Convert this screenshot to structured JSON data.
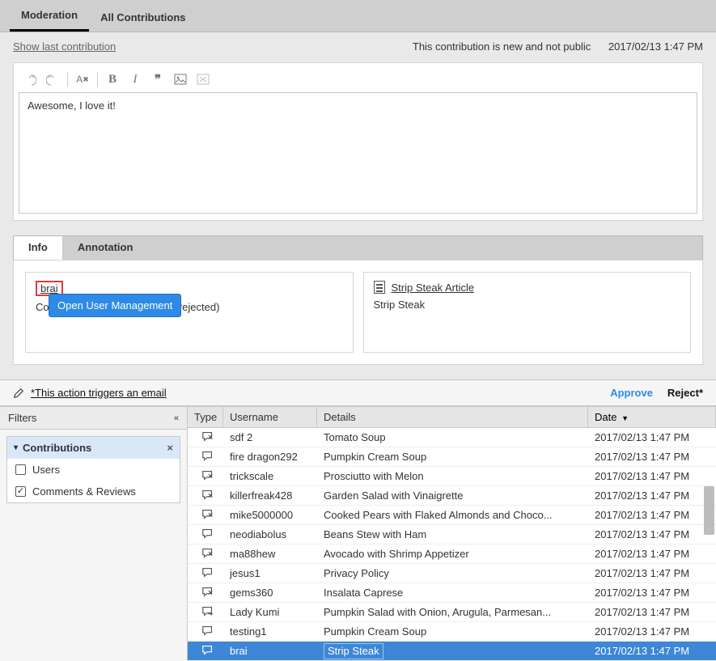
{
  "tabs": {
    "moderation": "Moderation",
    "all_contributions": "All Contributions"
  },
  "status": {
    "show_last": "Show last contribution",
    "message": "This contribution is new and not public",
    "date": "2017/02/13 1:47 PM"
  },
  "editor": {
    "content": "Awesome, I love it!"
  },
  "midtabs": {
    "info": "Info",
    "annotation": "Annotation"
  },
  "info": {
    "username": "brai",
    "tooltip": "Open User Management",
    "co_label": "Co",
    "co_suffix": "| (0 rejected)"
  },
  "article": {
    "link": "Strip Steak Article",
    "title": "Strip Steak"
  },
  "actions": {
    "email_note": "*This action triggers an email",
    "approve": "Approve",
    "reject": "Reject*"
  },
  "filters": {
    "title": "Filters",
    "group": "Contributions",
    "users": "Users",
    "comments": "Comments & Reviews"
  },
  "grid": {
    "headers": {
      "type": "Type",
      "username": "Username",
      "details": "Details",
      "date": "Date"
    },
    "rows": [
      {
        "icon": "x",
        "user": "sdf 2",
        "details": "Tomato Soup",
        "date": "2017/02/13 1:47 PM"
      },
      {
        "icon": "plain",
        "user": "fire dragon292",
        "details": "Pumpkin Cream Soup",
        "date": "2017/02/13 1:47 PM"
      },
      {
        "icon": "x",
        "user": "trickscale",
        "details": "Prosciutto with Melon",
        "date": "2017/02/13 1:47 PM"
      },
      {
        "icon": "x",
        "user": "killerfreak428",
        "details": "Garden Salad with Vinaigrette",
        "date": "2017/02/13 1:47 PM"
      },
      {
        "icon": "x",
        "user": "mike5000000",
        "details": "Cooked Pears with Flaked Almonds and Choco...",
        "date": "2017/02/13 1:47 PM"
      },
      {
        "icon": "plain",
        "user": "neodiabolus",
        "details": "Beans Stew with Ham",
        "date": "2017/02/13 1:47 PM"
      },
      {
        "icon": "x",
        "user": "ma88hew",
        "details": "Avocado with Shrimp Appetizer",
        "date": "2017/02/13 1:47 PM"
      },
      {
        "icon": "plain",
        "user": "jesus1",
        "details": "Privacy Policy",
        "date": "2017/02/13 1:47 PM"
      },
      {
        "icon": "x",
        "user": "gems360",
        "details": "Insalata Caprese",
        "date": "2017/02/13 1:47 PM"
      },
      {
        "icon": "reply",
        "user": "Lady Kumi",
        "details": "Pumpkin Salad with Onion, Arugula, Parmesan...",
        "date": "2017/02/13 1:47 PM"
      },
      {
        "icon": "plain",
        "user": "testing1",
        "details": "Pumpkin Cream Soup",
        "date": "2017/02/13 1:47 PM"
      },
      {
        "icon": "plain",
        "user": "brai",
        "details": "Strip Steak",
        "date": "2017/02/13 1:47 PM",
        "selected": true
      }
    ]
  }
}
